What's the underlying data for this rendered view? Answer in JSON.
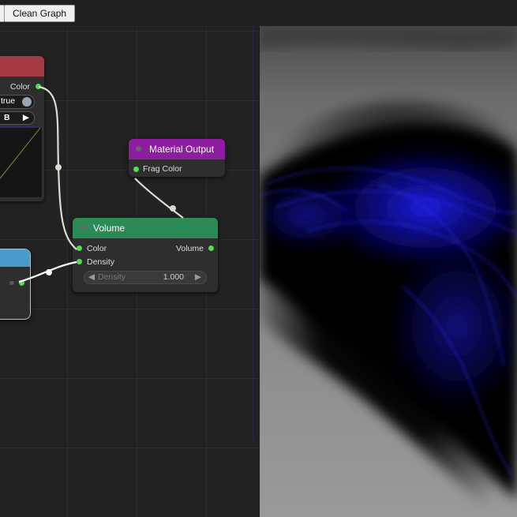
{
  "toolbar": {
    "clean_graph_label": "Clean Graph"
  },
  "nodes": {
    "color_node": {
      "output_label": "Color",
      "toggle_value": "true",
      "select_value": "B",
      "select_arrow": "▶",
      "header_color": "#a33a44"
    },
    "material_output": {
      "title": "Material Output",
      "input_label": "Frag Color",
      "header_color": "#8d1ea1"
    },
    "volume": {
      "title": "Volume",
      "input_color": "Color",
      "input_density": "Density",
      "output_volume": "Volume",
      "density_label": "Density",
      "density_value": "1.000",
      "arrow_left": "◀",
      "arrow_right": "▶",
      "header_color": "#2b8a55"
    },
    "number_node": {
      "output_label": "=",
      "header_color": "#4a9acc"
    }
  },
  "colors": {
    "socket": "#4ee04e",
    "wire": "#d8ddd0",
    "volume_glow": "#1a1aff"
  }
}
